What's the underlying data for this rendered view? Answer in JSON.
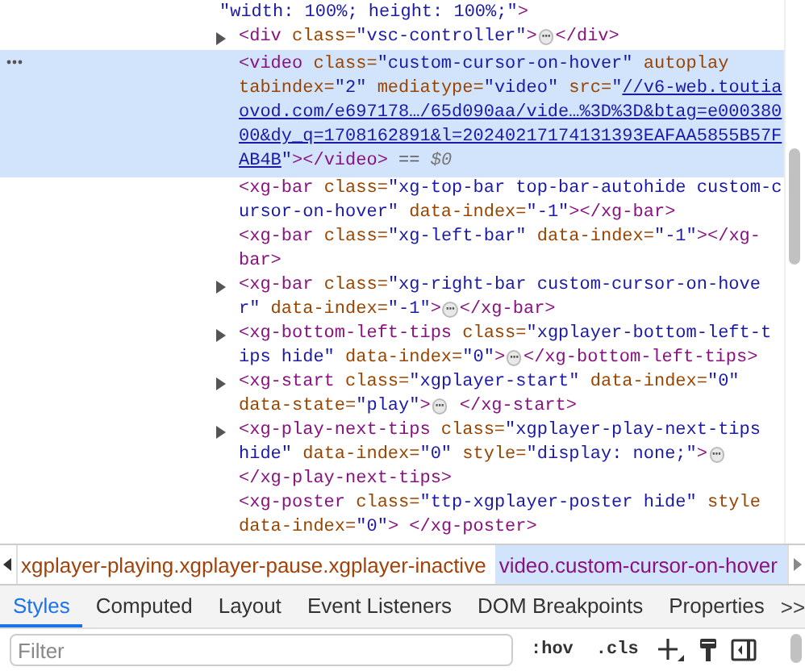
{
  "elements_tree": {
    "nodes": [
      {
        "kind": "attribute_tail",
        "expandable": false,
        "selected": false,
        "lines": [
          [
            {
              "kind": "val",
              "t": "\"width: 100%; height: 100%;\""
            },
            {
              "kind": "tag",
              "t": ">"
            }
          ]
        ]
      },
      {
        "kind": "element",
        "expandable": true,
        "selected": false,
        "lines": [
          [
            {
              "kind": "tag",
              "t": "<div"
            },
            {
              "kind": "attr",
              "t": " class="
            },
            {
              "kind": "val",
              "t": "\"vsc-controller\""
            },
            {
              "kind": "tag",
              "t": ">"
            },
            {
              "kind": "more",
              "t": "⋯"
            },
            {
              "kind": "tag",
              "t": "</div>"
            }
          ]
        ]
      },
      {
        "kind": "element",
        "expandable": false,
        "selected": true,
        "lines": [
          [
            {
              "kind": "tag",
              "t": "<video"
            },
            {
              "kind": "attr",
              "t": " class="
            },
            {
              "kind": "val",
              "t": "\"custom-cursor-on-hover\""
            },
            {
              "kind": "attr",
              "t": " autoplay"
            }
          ],
          [
            {
              "kind": "attr",
              "t": "tabindex="
            },
            {
              "kind": "val",
              "t": "\"2\""
            },
            {
              "kind": "attr",
              "t": " mediatype="
            },
            {
              "kind": "val",
              "t": "\"video\""
            },
            {
              "kind": "attr",
              "t": " src="
            },
            {
              "kind": "val",
              "t": "\""
            },
            {
              "kind": "link",
              "t": "//v6-web.toutia"
            }
          ],
          [
            {
              "kind": "link",
              "t": "ovod.com/e697178…/65d090aa/vide…%3D%3D&btag=e000380"
            }
          ],
          [
            {
              "kind": "link",
              "t": "00&dy_q=1708162891&l=20240217174131393EAFAA5855B57F"
            }
          ],
          [
            {
              "kind": "link",
              "t": "AB4B"
            },
            {
              "kind": "val",
              "t": "\""
            },
            {
              "kind": "tag",
              "t": "></video>"
            },
            {
              "kind": "plain",
              "t": " == "
            },
            {
              "kind": "ref",
              "t": "$0"
            }
          ]
        ]
      },
      {
        "kind": "element",
        "expandable": false,
        "selected": false,
        "lines": [
          [
            {
              "kind": "tag",
              "t": "<xg-bar"
            },
            {
              "kind": "attr",
              "t": " class="
            },
            {
              "kind": "val",
              "t": "\"xg-top-bar top-bar-autohide custom-c"
            }
          ],
          [
            {
              "kind": "val",
              "t": "ursor-on-hover\""
            },
            {
              "kind": "attr",
              "t": " data-index="
            },
            {
              "kind": "val",
              "t": "\"-1\""
            },
            {
              "kind": "tag",
              "t": "></xg-bar>"
            }
          ]
        ]
      },
      {
        "kind": "element",
        "expandable": false,
        "selected": false,
        "lines": [
          [
            {
              "kind": "tag",
              "t": "<xg-bar"
            },
            {
              "kind": "attr",
              "t": " class="
            },
            {
              "kind": "val",
              "t": "\"xg-left-bar\""
            },
            {
              "kind": "attr",
              "t": " data-index="
            },
            {
              "kind": "val",
              "t": "\"-1\""
            },
            {
              "kind": "tag",
              "t": "></xg-"
            }
          ],
          [
            {
              "kind": "tag",
              "t": "bar>"
            }
          ]
        ]
      },
      {
        "kind": "element",
        "expandable": true,
        "selected": false,
        "lines": [
          [
            {
              "kind": "tag",
              "t": "<xg-bar"
            },
            {
              "kind": "attr",
              "t": " class="
            },
            {
              "kind": "val",
              "t": "\"xg-right-bar custom-cursor-on-hove"
            }
          ],
          [
            {
              "kind": "val",
              "t": "r\""
            },
            {
              "kind": "attr",
              "t": " data-index="
            },
            {
              "kind": "val",
              "t": "\"-1\""
            },
            {
              "kind": "tag",
              "t": ">"
            },
            {
              "kind": "more",
              "t": "⋯"
            },
            {
              "kind": "tag",
              "t": "</xg-bar>"
            }
          ]
        ]
      },
      {
        "kind": "element",
        "expandable": true,
        "selected": false,
        "lines": [
          [
            {
              "kind": "tag",
              "t": "<xg-bottom-left-tips"
            },
            {
              "kind": "attr",
              "t": " class="
            },
            {
              "kind": "val",
              "t": "\"xgplayer-bottom-left-t"
            }
          ],
          [
            {
              "kind": "val",
              "t": "ips hide\""
            },
            {
              "kind": "attr",
              "t": " data-index="
            },
            {
              "kind": "val",
              "t": "\"0\""
            },
            {
              "kind": "tag",
              "t": ">"
            },
            {
              "kind": "more",
              "t": "⋯"
            },
            {
              "kind": "tag",
              "t": "</xg-bottom-left-tips>"
            }
          ]
        ]
      },
      {
        "kind": "element",
        "expandable": true,
        "selected": false,
        "lines": [
          [
            {
              "kind": "tag",
              "t": "<xg-start"
            },
            {
              "kind": "attr",
              "t": " class="
            },
            {
              "kind": "val",
              "t": "\"xgplayer-start\""
            },
            {
              "kind": "attr",
              "t": " data-index="
            },
            {
              "kind": "val",
              "t": "\"0\""
            }
          ],
          [
            {
              "kind": "attr",
              "t": "data-state="
            },
            {
              "kind": "val",
              "t": "\"play\""
            },
            {
              "kind": "tag",
              "t": ">"
            },
            {
              "kind": "more",
              "t": "⋯"
            },
            {
              "kind": "tag",
              "t": " </xg-start>"
            }
          ]
        ]
      },
      {
        "kind": "element",
        "expandable": true,
        "selected": false,
        "lines": [
          [
            {
              "kind": "tag",
              "t": "<xg-play-next-tips"
            },
            {
              "kind": "attr",
              "t": " class="
            },
            {
              "kind": "val",
              "t": "\"xgplayer-play-next-tips"
            }
          ],
          [
            {
              "kind": "val",
              "t": "hide\""
            },
            {
              "kind": "attr",
              "t": " data-index="
            },
            {
              "kind": "val",
              "t": "\"0\""
            },
            {
              "kind": "attr",
              "t": " style="
            },
            {
              "kind": "val",
              "t": "\"display: none;\""
            },
            {
              "kind": "tag",
              "t": ">"
            },
            {
              "kind": "more",
              "t": "⋯"
            }
          ],
          [
            {
              "kind": "tag",
              "t": "</xg-play-next-tips>"
            }
          ]
        ]
      },
      {
        "kind": "element",
        "expandable": false,
        "selected": false,
        "lines": [
          [
            {
              "kind": "tag",
              "t": "<xg-poster"
            },
            {
              "kind": "attr",
              "t": " class="
            },
            {
              "kind": "val",
              "t": "\"ttp-xgplayer-poster hide\""
            },
            {
              "kind": "attr",
              "t": " style"
            }
          ],
          [
            {
              "kind": "attr",
              "t": "data-index="
            },
            {
              "kind": "val",
              "t": "\"0\""
            },
            {
              "kind": "tag",
              "t": "> </xg-poster>"
            }
          ]
        ]
      }
    ]
  },
  "breadcrumbs": [
    {
      "label": "xgplayer-playing.xgplayer-pause.xgplayer-inactive",
      "selected": false
    },
    {
      "label": "video.custom-cursor-on-hover",
      "selected": true
    }
  ],
  "tabs": [
    {
      "label": "Styles",
      "selected": true
    },
    {
      "label": "Computed",
      "selected": false
    },
    {
      "label": "Layout",
      "selected": false
    },
    {
      "label": "Event Listeners",
      "selected": false
    },
    {
      "label": "DOM Breakpoints",
      "selected": false
    },
    {
      "label": "Properties",
      "selected": false
    }
  ],
  "more_tabs": ">>",
  "filter": {
    "placeholder": "Filter"
  },
  "toggles": [
    ":hov",
    ".cls"
  ]
}
